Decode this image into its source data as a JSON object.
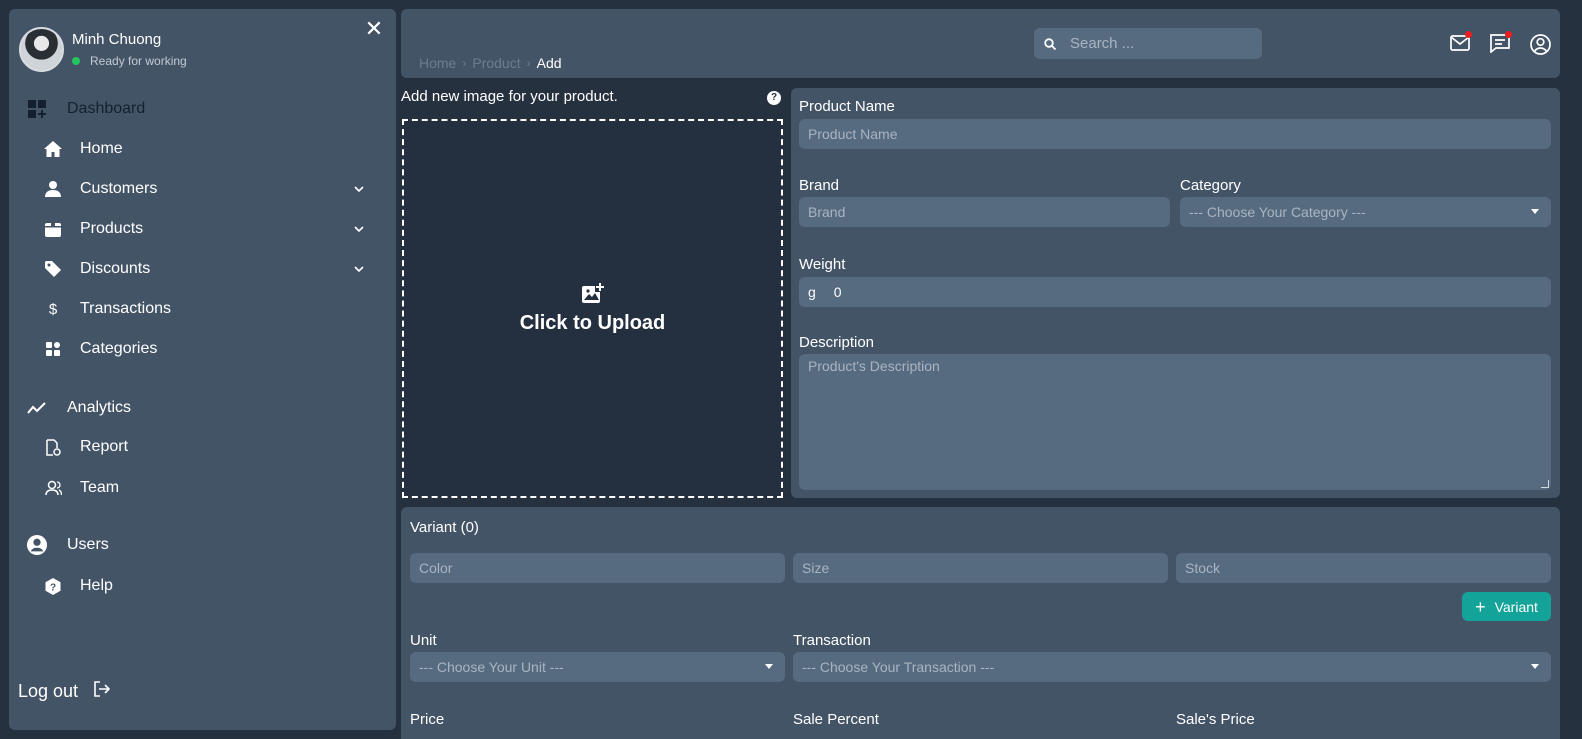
{
  "user": {
    "name": "Minh Chuong",
    "status": "Ready for working"
  },
  "sidebar": {
    "items": [
      {
        "label": "Dashboard",
        "icon": "dashboard-icon"
      },
      {
        "label": "Home",
        "icon": "home-icon"
      },
      {
        "label": "Customers",
        "icon": "user-icon",
        "expandable": true
      },
      {
        "label": "Products",
        "icon": "box-icon",
        "expandable": true
      },
      {
        "label": "Discounts",
        "icon": "tag-icon",
        "expandable": true
      },
      {
        "label": "Transactions",
        "icon": "dollar-icon"
      },
      {
        "label": "Categories",
        "icon": "grid-icon"
      },
      {
        "label": "Analytics",
        "icon": "chart-line-icon"
      },
      {
        "label": "Report",
        "icon": "report-icon"
      },
      {
        "label": "Team",
        "icon": "team-icon"
      },
      {
        "label": "Users",
        "icon": "user-circle-icon"
      },
      {
        "label": "Help",
        "icon": "help-icon"
      }
    ],
    "logout": "Log out"
  },
  "header": {
    "breadcrumb": [
      "Home",
      "Product",
      "Add"
    ],
    "search_placeholder": "Search ..."
  },
  "upload": {
    "title": "Add new image for your product.",
    "help": "?",
    "button": "Click to Upload"
  },
  "form": {
    "product_name_label": "Product Name",
    "product_name_placeholder": "Product Name",
    "brand_label": "Brand",
    "brand_placeholder": "Brand",
    "category_label": "Category",
    "category_value": "--- Choose Your Category ---",
    "weight_label": "Weight",
    "weight_unit": "g",
    "weight_value": "0",
    "description_label": "Description",
    "description_placeholder": "Product's Description"
  },
  "variant": {
    "title": "Variant (0)",
    "color_placeholder": "Color",
    "size_placeholder": "Size",
    "stock_placeholder": "Stock",
    "add_button": "Variant",
    "unit_label": "Unit",
    "unit_value": "--- Choose Your Unit ---",
    "transaction_label": "Transaction",
    "transaction_value": "--- Choose Your Transaction ---",
    "price_label": "Price",
    "sale_percent_label": "Sale Percent",
    "sale_price_label": "Sale's Price"
  },
  "colors": {
    "background": "#263140",
    "panel": "#445467",
    "input": "#566a80",
    "accent": "#14a399",
    "status": "#22c55e",
    "notification": "#ef1d1d"
  }
}
